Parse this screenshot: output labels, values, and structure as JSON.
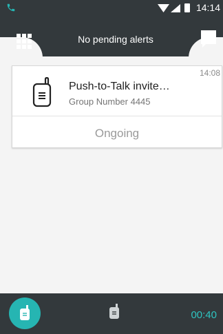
{
  "status_bar": {
    "time": "14:14"
  },
  "header": {
    "alert_text": "No pending alerts"
  },
  "call_card": {
    "time": "14:08",
    "title": "Push-to-Talk invite…",
    "subtitle": "Group Number 4445",
    "status": "Ongoing"
  },
  "bottom_bar": {
    "timer": "00:40"
  },
  "colors": {
    "dark": "#33393c",
    "accent": "#26b5b2",
    "background": "#f4f4f4"
  },
  "icons": [
    "phone-icon",
    "wifi-icon",
    "signal-icon",
    "battery-icon",
    "grid-menu-icon",
    "chat-icon",
    "walkie-talkie-icon"
  ]
}
